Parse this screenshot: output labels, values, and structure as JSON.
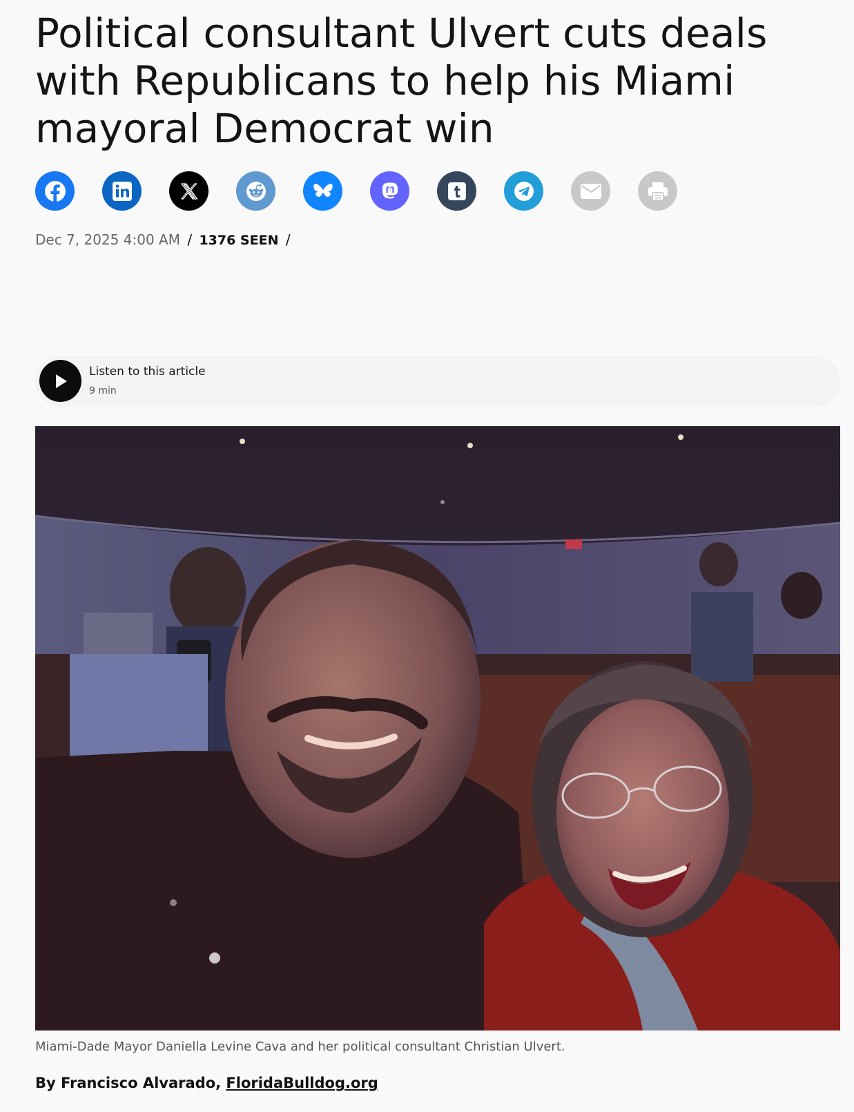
{
  "article": {
    "title": "Political consultant Ulvert cuts deals with Republicans to help his Miami mayoral Democrat win",
    "date": "Dec 7, 2025 4:00 AM",
    "separator": "/",
    "seen": "1376 SEEN",
    "caption": "Miami-Dade Mayor Daniella Levine Cava and her political consultant Christian Ulvert.",
    "byline_prefix": "By Francisco Alvarado, ",
    "byline_link": "FloridaBulldog.org"
  },
  "share": {
    "buttons": [
      {
        "icon": "facebook-icon",
        "color": "#1877f2"
      },
      {
        "icon": "linkedin-icon",
        "color": "#0a66c2"
      },
      {
        "icon": "x-icon",
        "color": "#000000"
      },
      {
        "icon": "reddit-icon",
        "color": "#5f99cf"
      },
      {
        "icon": "bluesky-icon",
        "color": "#1185fe"
      },
      {
        "icon": "mastodon-icon",
        "color": "#6364ff"
      },
      {
        "icon": "tumblr-icon",
        "color": "#35465c"
      },
      {
        "icon": "telegram-icon",
        "color": "#229ed9"
      },
      {
        "icon": "email-icon",
        "color": "#c8c8c8"
      },
      {
        "icon": "print-icon",
        "color": "#c8c8c8"
      }
    ]
  },
  "audio": {
    "label": "Listen to this article",
    "duration": "9 min"
  }
}
